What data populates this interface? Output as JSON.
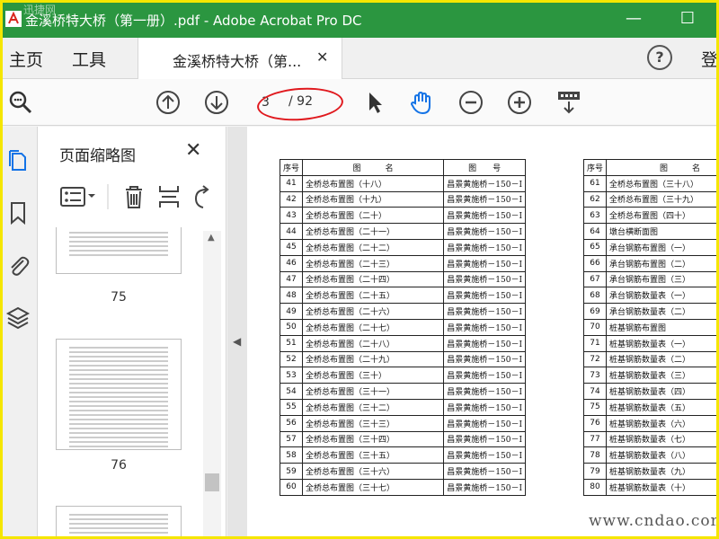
{
  "window": {
    "title": "金溪桥特大桥（第一册）.pdf - Adobe Acrobat Pro DC",
    "watermark_top": "迅捷网",
    "accent": "#2b9640"
  },
  "tabs": {
    "home": "主页",
    "tools": "工具",
    "document": "金溪桥特大桥（第...",
    "help": "?",
    "login": "登"
  },
  "toolbar": {
    "page_current": "3",
    "page_total": "/ 92"
  },
  "panel": {
    "title": "页面缩略图",
    "thumbnails": [
      {
        "label": "75"
      },
      {
        "label": "76"
      }
    ]
  },
  "doc": {
    "header": {
      "seq": "序号",
      "name": "图　　　名",
      "code": "图　　号"
    },
    "left_rows": [
      {
        "n": "41",
        "name": "全桥总布置图（十八）",
        "code": "昌景黄施桥－150－Ⅰ"
      },
      {
        "n": "42",
        "name": "全桥总布置图（十九）",
        "code": "昌景黄施桥－150－Ⅰ"
      },
      {
        "n": "43",
        "name": "全桥总布置图（二十）",
        "code": "昌景黄施桥－150－Ⅰ"
      },
      {
        "n": "44",
        "name": "全桥总布置图（二十一）",
        "code": "昌景黄施桥－150－Ⅰ"
      },
      {
        "n": "45",
        "name": "全桥总布置图（二十二）",
        "code": "昌景黄施桥－150－Ⅰ"
      },
      {
        "n": "46",
        "name": "全桥总布置图（二十三）",
        "code": "昌景黄施桥－150－Ⅰ"
      },
      {
        "n": "47",
        "name": "全桥总布置图（二十四）",
        "code": "昌景黄施桥－150－Ⅰ"
      },
      {
        "n": "48",
        "name": "全桥总布置图（二十五）",
        "code": "昌景黄施桥－150－Ⅰ"
      },
      {
        "n": "49",
        "name": "全桥总布置图（二十六）",
        "code": "昌景黄施桥－150－Ⅰ"
      },
      {
        "n": "50",
        "name": "全桥总布置图（二十七）",
        "code": "昌景黄施桥－150－Ⅰ"
      },
      {
        "n": "51",
        "name": "全桥总布置图（二十八）",
        "code": "昌景黄施桥－150－Ⅰ"
      },
      {
        "n": "52",
        "name": "全桥总布置图（二十九）",
        "code": "昌景黄施桥－150－Ⅰ"
      },
      {
        "n": "53",
        "name": "全桥总布置图（三十）",
        "code": "昌景黄施桥－150－Ⅰ"
      },
      {
        "n": "54",
        "name": "全桥总布置图（三十一）",
        "code": "昌景黄施桥－150－Ⅰ"
      },
      {
        "n": "55",
        "name": "全桥总布置图（三十二）",
        "code": "昌景黄施桥－150－Ⅰ"
      },
      {
        "n": "56",
        "name": "全桥总布置图（三十三）",
        "code": "昌景黄施桥－150－Ⅰ"
      },
      {
        "n": "57",
        "name": "全桥总布置图（三十四）",
        "code": "昌景黄施桥－150－Ⅰ"
      },
      {
        "n": "58",
        "name": "全桥总布置图（三十五）",
        "code": "昌景黄施桥－150－Ⅰ"
      },
      {
        "n": "59",
        "name": "全桥总布置图（三十六）",
        "code": "昌景黄施桥－150－Ⅰ"
      },
      {
        "n": "60",
        "name": "全桥总布置图（三十七）",
        "code": "昌景黄施桥－150－Ⅰ"
      }
    ],
    "right_rows": [
      {
        "n": "61",
        "name": "全桥总布置图（三十八）"
      },
      {
        "n": "62",
        "name": "全桥总布置图（三十九）"
      },
      {
        "n": "63",
        "name": "全桥总布置图（四十）"
      },
      {
        "n": "64",
        "name": "墩台横断面图"
      },
      {
        "n": "65",
        "name": "承台钢筋布置图（一）"
      },
      {
        "n": "66",
        "name": "承台钢筋布置图（二）"
      },
      {
        "n": "67",
        "name": "承台钢筋布置图（三）"
      },
      {
        "n": "68",
        "name": "承台钢筋数量表（一）"
      },
      {
        "n": "69",
        "name": "承台钢筋数量表（二）"
      },
      {
        "n": "70",
        "name": "桩基钢筋布置图"
      },
      {
        "n": "71",
        "name": "桩基钢筋数量表（一）"
      },
      {
        "n": "72",
        "name": "桩基钢筋数量表（二）"
      },
      {
        "n": "73",
        "name": "桩基钢筋数量表（三）"
      },
      {
        "n": "74",
        "name": "桩基钢筋数量表（四）"
      },
      {
        "n": "75",
        "name": "桩基钢筋数量表（五）"
      },
      {
        "n": "76",
        "name": "桩基钢筋数量表（六）"
      },
      {
        "n": "77",
        "name": "桩基钢筋数量表（七）"
      },
      {
        "n": "78",
        "name": "桩基钢筋数量表（八）"
      },
      {
        "n": "79",
        "name": "桩基钢筋数量表（九）"
      },
      {
        "n": "80",
        "name": "桩基钢筋数量表（十）"
      }
    ]
  },
  "watermark_bottom": "www.cndao.com"
}
